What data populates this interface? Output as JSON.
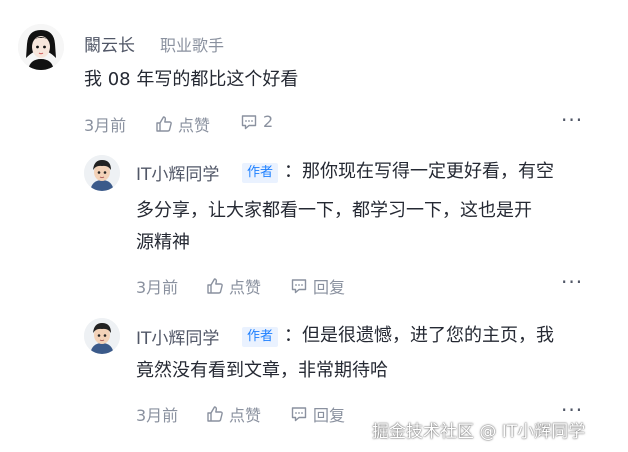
{
  "comment": {
    "author": "闞云长",
    "author_tag": "职业歌手",
    "text": "我 08 年写的都比这个好看",
    "time": "3月前",
    "like_label": "点赞",
    "reply_count": "2"
  },
  "replies": [
    {
      "author": "IT小辉同学",
      "badge": "作者",
      "line1": "：那你现在写得一定更好看，有空",
      "line2": "多分享，让大家都看一下，都学习一下，这也是开",
      "line3": "源精神",
      "time": "3月前",
      "like_label": "点赞",
      "reply_label": "回复"
    },
    {
      "author": "IT小辉同学",
      "badge": "作者",
      "line1": "：但是很遗憾，进了您的主页，我",
      "line2": "竟然没有看到文章，非常期待哈",
      "time": "3月前",
      "like_label": "点赞",
      "reply_label": "回复"
    }
  ],
  "more_label": "···",
  "watermark": "掘金技术社区 @ IT小辉同学",
  "colors": {
    "accent": "#1e80ff",
    "badge_bg": "#eaf2ff",
    "meta": "#8a919f",
    "text": "#252933"
  }
}
